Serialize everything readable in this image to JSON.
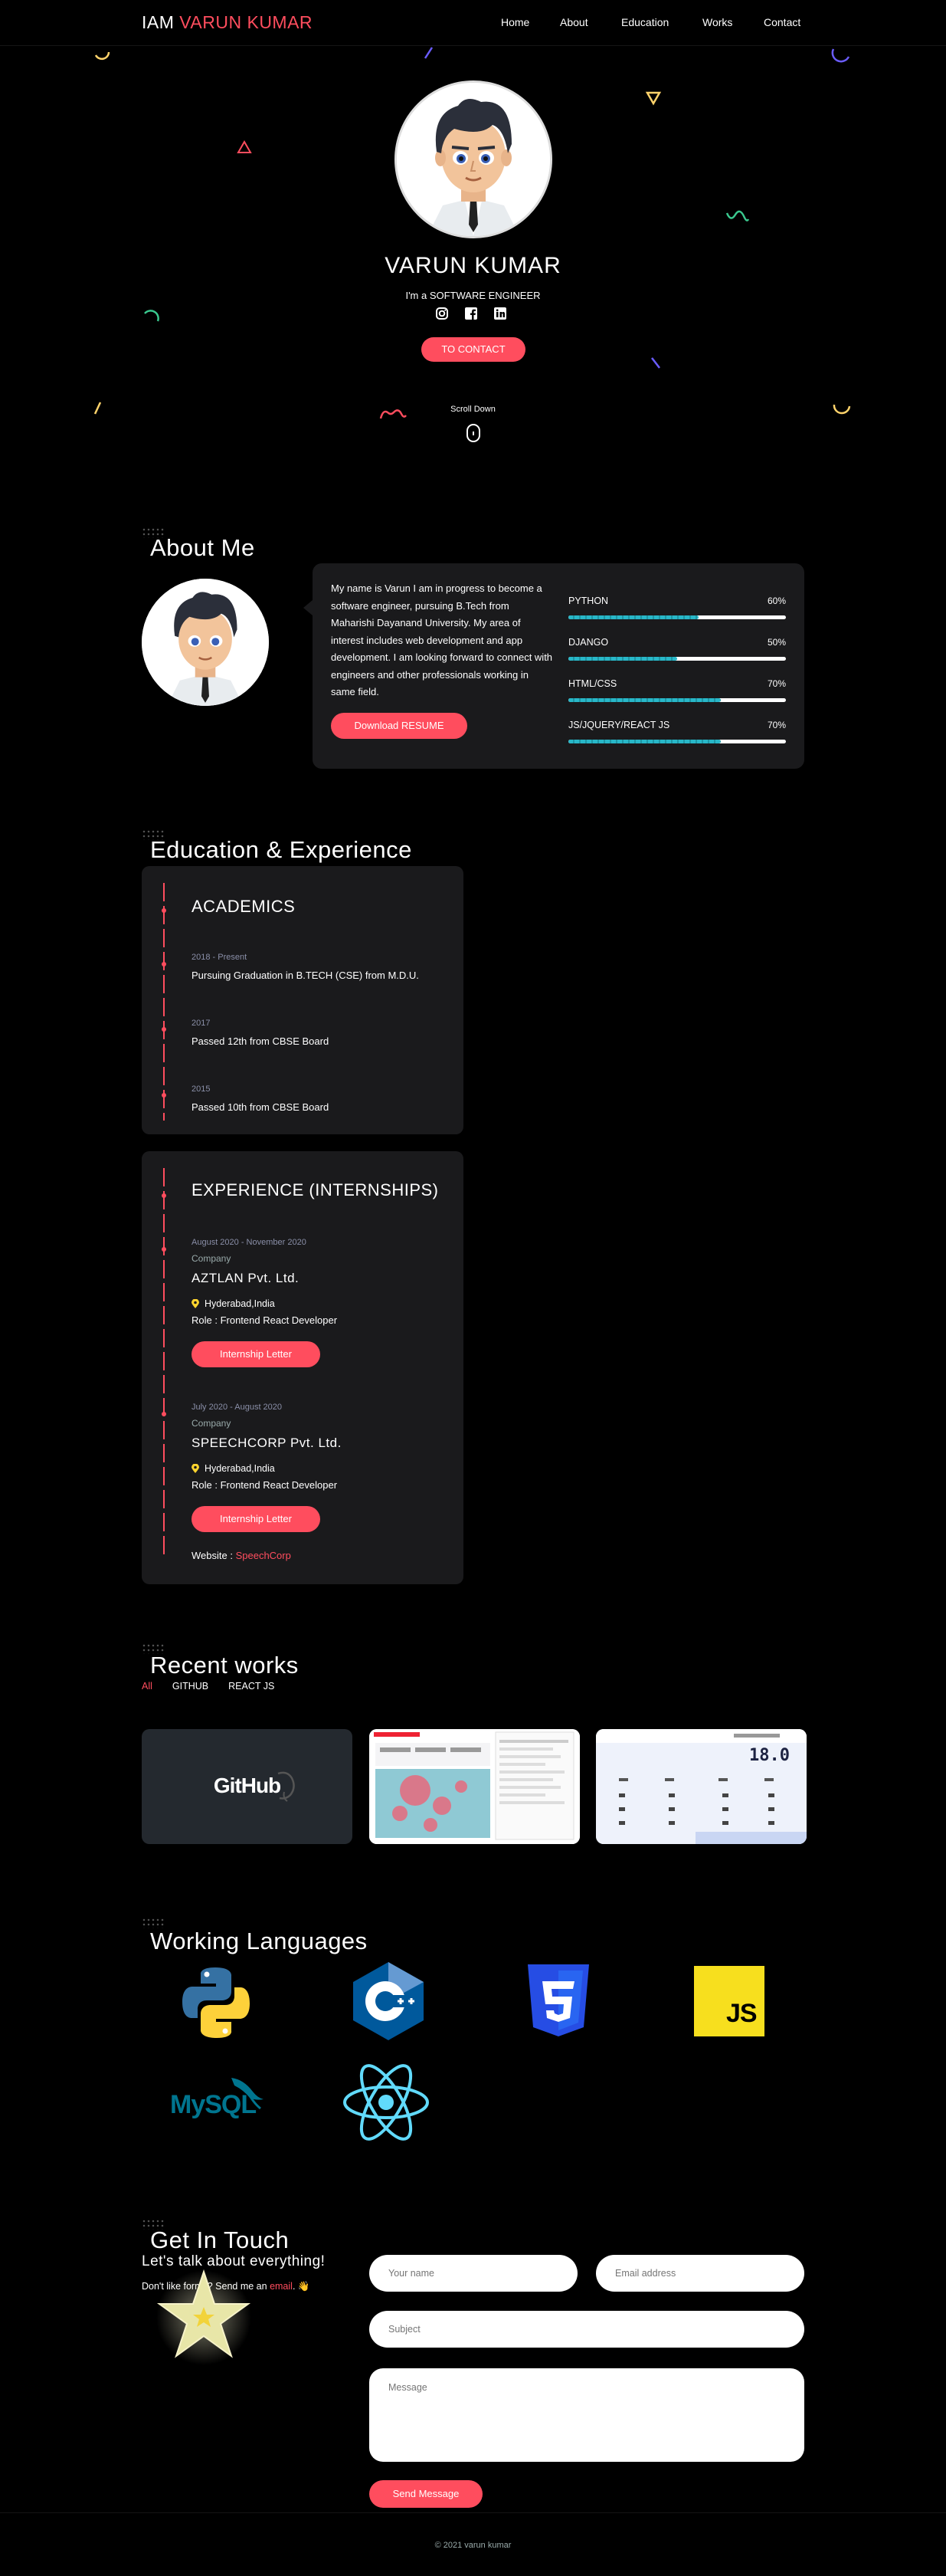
{
  "nav": {
    "brand_prefix": "IAM",
    "brand_name": "VARUN KUMAR",
    "links": [
      "Home",
      "About",
      "Education",
      "Works",
      "Contact"
    ]
  },
  "hero": {
    "name": "VARUN KUMAR",
    "subtitle": "I'm a SOFTWARE ENGINEER",
    "contact_button": "TO CONTACT",
    "scroll_label": "Scroll Down",
    "social_icons": [
      "instagram-icon",
      "facebook-icon",
      "linkedin-icon"
    ]
  },
  "about": {
    "title": "About Me",
    "text": "My name is Varun I am in progress to become a software engineer, pursuing B.Tech from Maharishi Dayanand University. My area of interest includes web development and app development. I am looking forward to connect with engineers and other professionals working in same field.",
    "resume_button": "Download RESUME",
    "skills": [
      {
        "name": "PYTHON",
        "percent_label": "60%",
        "value": 0.6
      },
      {
        "name": "DJANGO",
        "percent_label": "50%",
        "value": 0.5
      },
      {
        "name": "HTML/CSS",
        "percent_label": "70%",
        "value": 0.7
      },
      {
        "name": "JS/JQUERY/REACT JS",
        "percent_label": "70%",
        "value": 0.7
      }
    ]
  },
  "education": {
    "title": "Education & Experience",
    "academics_title": "ACADEMICS",
    "academics": [
      {
        "date": "2018 - Present",
        "text": "Pursuing Graduation in B.TECH (CSE) from M.D.U."
      },
      {
        "date": "2017",
        "text": "Passed 12th from CBSE Board"
      },
      {
        "date": "2015",
        "text": "Passed 10th from CBSE Board"
      }
    ],
    "experience_title": "EXPERIENCE (INTERNSHIPS)",
    "experience": [
      {
        "date": "August 2020 - November 2020",
        "label": "Company",
        "company": "AZTLAN Pvt. Ltd.",
        "location": "Hyderabad,India",
        "role": "Role : Frontend React Developer",
        "button": "Internship Letter"
      },
      {
        "date": "July 2020 - August 2020",
        "label": "Company",
        "company": "SPEECHCORP Pvt. Ltd.",
        "location": "Hyderabad,India",
        "role": "Role : Frontend React Developer",
        "button": "Internship Letter"
      }
    ],
    "website_label": "Website :",
    "website_link": "SpeechCorp"
  },
  "works": {
    "title": "Recent works",
    "filters": [
      "All",
      "GITHUB",
      "REACT JS"
    ],
    "github_text": "GitHub",
    "calc_display": "18.0"
  },
  "languages": {
    "title": "Working Languages",
    "icons": [
      "python-icon",
      "cpp-icon",
      "css3-icon",
      "javascript-icon",
      "mysql-icon",
      "react-icon"
    ],
    "js_text": "JS",
    "mysql_text": "MySQL"
  },
  "contact": {
    "title": "Get In Touch",
    "subtitle": "Let's talk about everything!",
    "text_prefix": "Don't like forms? Send me an",
    "text_link": "email",
    "text_suffix": ". 👋",
    "name_placeholder": "Your name",
    "email_placeholder": "Email address",
    "subject_placeholder": "Subject",
    "message_placeholder": "Message",
    "send_button": "Send Message"
  },
  "footer": {
    "text": "© 2021 varun kumar"
  },
  "colors": {
    "accent": "#ff4d5e",
    "card": "#1a1a1c",
    "bar": "#28b7c8"
  }
}
